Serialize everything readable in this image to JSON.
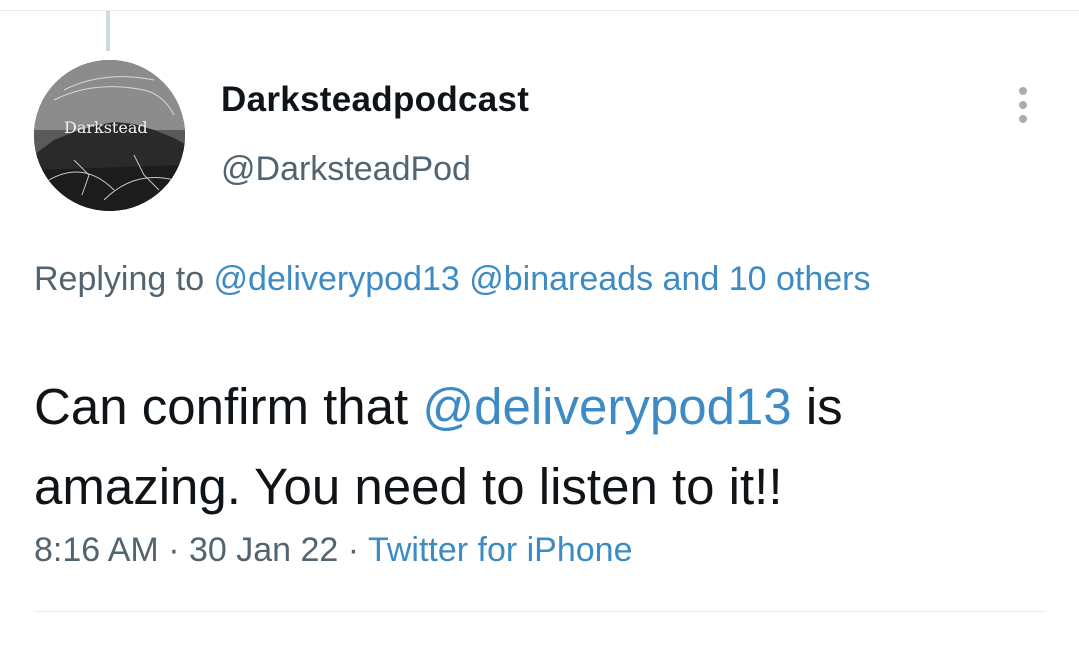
{
  "tweet": {
    "author": {
      "display_name": "Darksteadpodcast",
      "handle": "@DarksteadPod",
      "avatar_text": "Darkstead"
    },
    "reply_context": {
      "prefix": "Replying to ",
      "mentions": [
        "@deliverypod13",
        "@binareads"
      ],
      "suffix": "and 10 others"
    },
    "body": {
      "before": "Can confirm that ",
      "mention": "@deliverypod13",
      "after": " is amazing. You need to listen to it!!"
    },
    "meta": {
      "time": "8:16 AM",
      "separator": " · ",
      "date": "30 Jan 22",
      "source": "Twitter for iPhone"
    }
  },
  "icons": {
    "more": "more-vertical-icon"
  },
  "colors": {
    "link": "#3d8bc4",
    "secondary_text": "#536471",
    "primary_text": "#0f1419"
  }
}
